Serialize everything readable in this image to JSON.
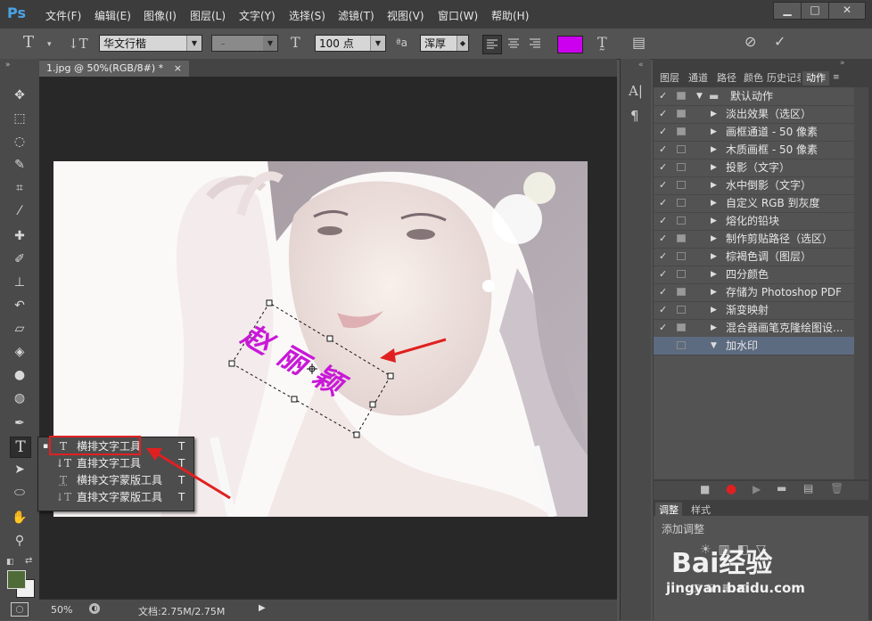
{
  "menubar": {
    "logo": "Ps",
    "items": [
      "文件(F)",
      "编辑(E)",
      "图像(I)",
      "图层(L)",
      "文字(Y)",
      "选择(S)",
      "滤镜(T)",
      "视图(V)",
      "窗口(W)",
      "帮助(H)"
    ],
    "window_buttons": [
      "▁",
      "□",
      "✕"
    ]
  },
  "options": {
    "font_family": "华文行楷",
    "font_style": "-",
    "font_size": "100 点",
    "aa_label": "ªa",
    "antialias": "浑厚",
    "color_swatch": "#cc00ee"
  },
  "document": {
    "tab_title": "1.jpg @ 50%(RGB/8#) *",
    "tab_close": "×",
    "overlay_text": "赵丽颖",
    "text_color": "#c818d8"
  },
  "statusbar": {
    "zoom": "50%",
    "doc_info": "文档:2.75M/2.75M"
  },
  "flyout": {
    "items": [
      {
        "icon": "T",
        "label": "横排文字工具",
        "key": "T"
      },
      {
        "icon": "↓T",
        "label": "直排文字工具",
        "key": "T"
      },
      {
        "icon": "T",
        "label": "横排文字蒙版工具",
        "key": "T"
      },
      {
        "icon": "↓T",
        "label": "直排文字蒙版工具",
        "key": "T"
      }
    ]
  },
  "panel_tabs": [
    "图层",
    "通道",
    "路径",
    "颜色",
    "历史记录",
    "动作"
  ],
  "actions": [
    {
      "label": "默认动作",
      "check": "✓",
      "dialog": true,
      "kind": "folder"
    },
    {
      "label": "淡出效果（选区）",
      "check": "✓",
      "dialog": true,
      "kind": "action"
    },
    {
      "label": "画框通道 - 50 像素",
      "check": "✓",
      "dialog": true,
      "kind": "action"
    },
    {
      "label": "木质画框 - 50 像素",
      "check": "✓",
      "dialog": false,
      "kind": "action"
    },
    {
      "label": "投影（文字）",
      "check": "✓",
      "dialog": false,
      "kind": "action"
    },
    {
      "label": "水中倒影（文字）",
      "check": "✓",
      "dialog": false,
      "kind": "action"
    },
    {
      "label": "自定义 RGB 到灰度",
      "check": "✓",
      "dialog": false,
      "kind": "action"
    },
    {
      "label": "熔化的铅块",
      "check": "✓",
      "dialog": false,
      "kind": "action"
    },
    {
      "label": "制作剪贴路径（选区）",
      "check": "✓",
      "dialog": true,
      "kind": "action"
    },
    {
      "label": "棕褐色调（图层）",
      "check": "✓",
      "dialog": false,
      "kind": "action"
    },
    {
      "label": "四分颜色",
      "check": "✓",
      "dialog": false,
      "kind": "action"
    },
    {
      "label": "存储为 Photoshop PDF",
      "check": "✓",
      "dialog": true,
      "kind": "action"
    },
    {
      "label": "渐变映射",
      "check": "✓",
      "dialog": false,
      "kind": "action"
    },
    {
      "label": "混合器画笔克隆绘图设...",
      "check": "✓",
      "dialog": true,
      "kind": "action"
    },
    {
      "label": "加水印",
      "check": "",
      "dialog": false,
      "kind": "action-open"
    }
  ],
  "adjust_panel": {
    "tabs": [
      "调整",
      "样式"
    ],
    "title": "添加调整"
  },
  "watermark": {
    "brand": "Bai经验",
    "url": "jingyan.baidu.com"
  }
}
